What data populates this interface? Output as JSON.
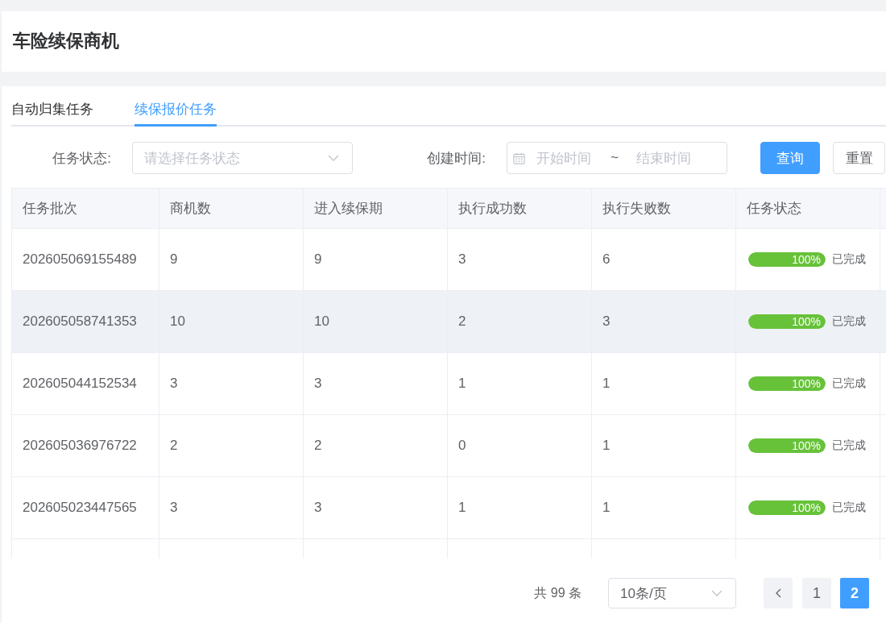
{
  "header": {
    "title": "车险续保商机"
  },
  "tabs": [
    {
      "label": "自动归集任务",
      "selected": false
    },
    {
      "label": "续保报价任务",
      "selected": true
    }
  ],
  "filters": {
    "status": {
      "label": "任务状态:",
      "placeholder": "请选择任务状态"
    },
    "created_time": {
      "label": "创建时间:",
      "start_placeholder": "开始时间",
      "separator": "~",
      "end_placeholder": "结束时间"
    }
  },
  "buttons": [
    {
      "label": "查询",
      "kind": "primary"
    },
    {
      "label": "重置",
      "kind": "default"
    }
  ],
  "table": {
    "columns": [
      "任务批次",
      "商机数",
      "进入续保期",
      "执行成功数",
      "执行失败数",
      "任务状态"
    ],
    "rows": [
      {
        "cells": [
          "202605069155489",
          "9",
          "9",
          "3",
          "6"
        ],
        "progress": {
          "level": 1,
          "label": "100%"
        },
        "status": "已完成",
        "highlighted": false
      },
      {
        "cells": [
          "202605058741353",
          "10",
          "10",
          "2",
          "3"
        ],
        "progress": {
          "level": 1,
          "label": "100%"
        },
        "status": "已完成",
        "highlighted": true
      },
      {
        "cells": [
          "202605044152534",
          "3",
          "3",
          "1",
          "1"
        ],
        "progress": {
          "level": 1,
          "label": "100%"
        },
        "status": "已完成",
        "highlighted": false
      },
      {
        "cells": [
          "202605036976722",
          "2",
          "2",
          "0",
          "1"
        ],
        "progress": {
          "level": 1,
          "label": "100%"
        },
        "status": "已完成",
        "highlighted": false
      },
      {
        "cells": [
          "202605023447565",
          "3",
          "3",
          "1",
          "1"
        ],
        "progress": {
          "level": 1,
          "label": "100%"
        },
        "status": "已完成",
        "highlighted": false
      }
    ]
  },
  "pagination": {
    "total": "共 99 条",
    "page_size": "10条/页",
    "pages": [
      {
        "label": "1",
        "selected": false
      },
      {
        "label": "2",
        "selected": true
      }
    ]
  }
}
